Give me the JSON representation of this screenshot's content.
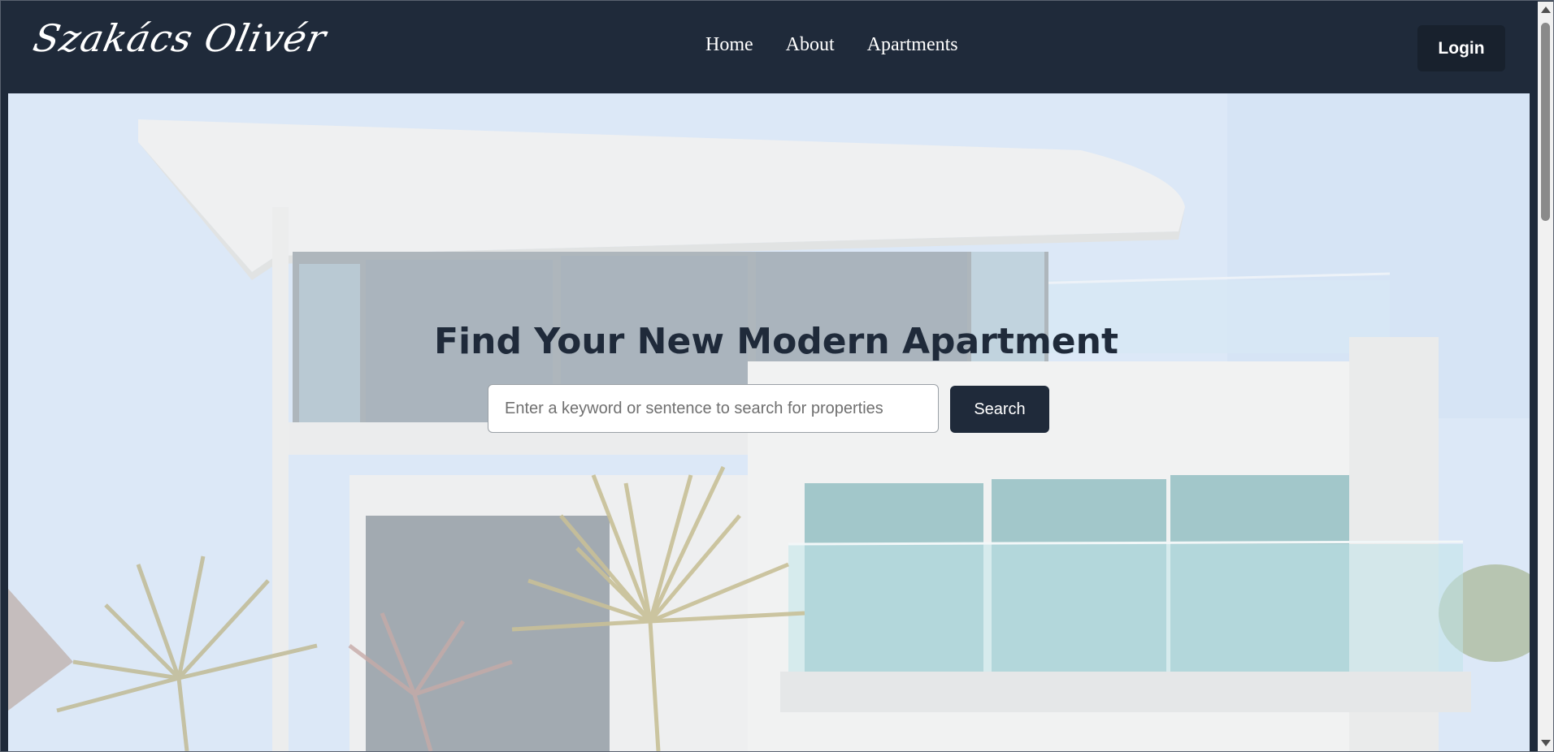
{
  "header": {
    "logo_text": "Szakács Olivér",
    "nav": [
      {
        "label": "Home"
      },
      {
        "label": "About"
      },
      {
        "label": "Apartments"
      }
    ],
    "login_label": "Login"
  },
  "hero": {
    "title": "Find Your New Modern Apartment",
    "search": {
      "placeholder": "Enter a keyword or sentence to search for properties",
      "value": "",
      "button_label": "Search"
    },
    "background_image": "modern-white-house-photo"
  },
  "colors": {
    "header_bg": "#1f2a3a",
    "button_bg": "#1f2a3a",
    "text_light": "#ffffff",
    "title_text": "#1f2a3a"
  }
}
